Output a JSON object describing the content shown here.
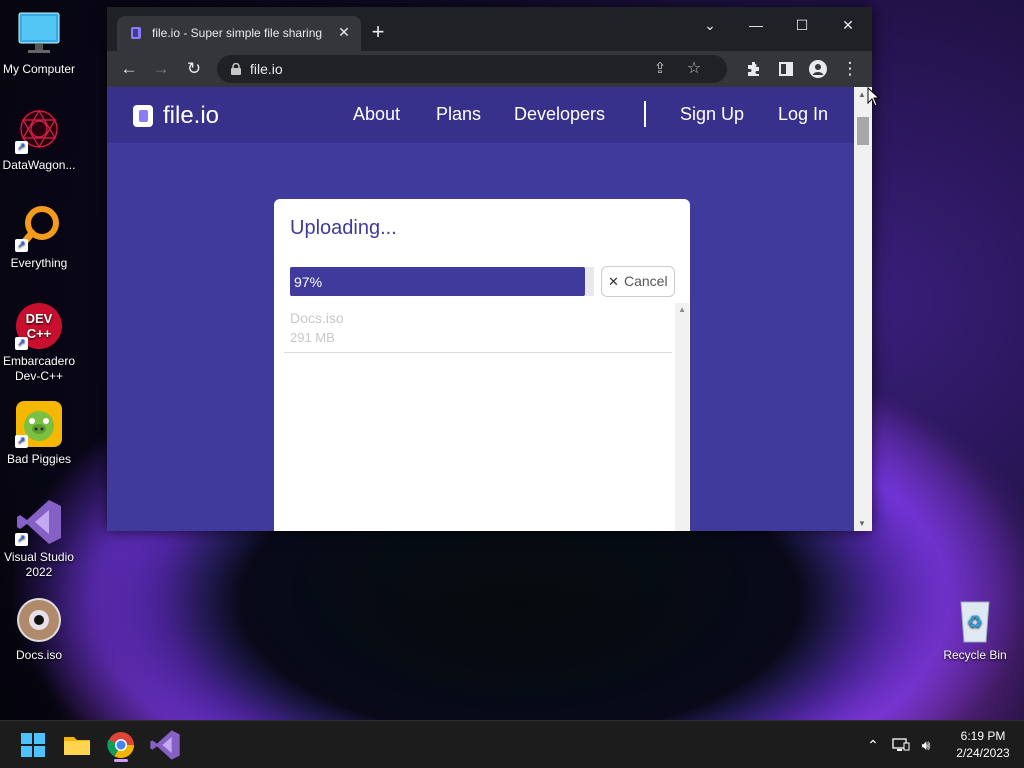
{
  "desktop": {
    "icons": [
      {
        "label": "My Computer"
      },
      {
        "label": "DataWagon..."
      },
      {
        "label": "Everything"
      },
      {
        "label": "Embarcadero Dev-C++"
      },
      {
        "label": "Bad Piggies"
      },
      {
        "label": "Visual Studio 2022"
      },
      {
        "label": "Docs.iso"
      },
      {
        "label": "Recycle Bin"
      }
    ]
  },
  "browser": {
    "tab_title": "file.io - Super simple file sharing",
    "url": "file.io",
    "new_tab_symbol": "+",
    "close_tab_symbol": "✕"
  },
  "site": {
    "logo_text": "file.io",
    "nav": {
      "about": "About",
      "plans": "Plans",
      "developers": "Developers",
      "signup": "Sign Up",
      "login": "Log In"
    },
    "upload": {
      "title": "Uploading...",
      "progress_label": "97%",
      "progress_fraction": 0.97,
      "cancel_label": "Cancel",
      "files": [
        {
          "name": "Docs.iso",
          "size": "291 MB"
        }
      ]
    }
  },
  "taskbar": {
    "time": "6:19 PM",
    "date": "2/24/2023"
  },
  "colors": {
    "accent": "#3f3a9c",
    "nav_bg": "#37318b",
    "browser_frame": "#202124",
    "taskbar": "#1c1c1c"
  }
}
